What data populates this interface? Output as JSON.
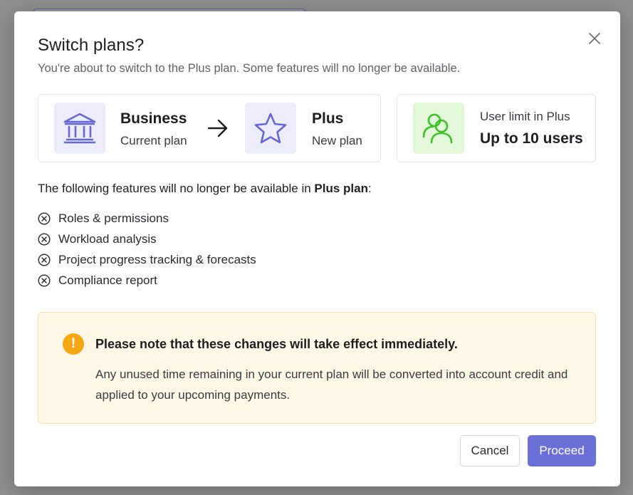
{
  "dialog": {
    "title": "Switch plans?",
    "subtitle": "You're about to switch to the Plus plan. Some features will no longer be available."
  },
  "plans": {
    "current": {
      "name": "Business",
      "caption": "Current plan",
      "icon": "bank-icon"
    },
    "new": {
      "name": "Plus",
      "caption": "New plan",
      "icon": "star-icon"
    }
  },
  "user_limit": {
    "label": "User limit in Plus",
    "value": "Up to 10 users",
    "icon": "users-icon"
  },
  "features": {
    "intro": "The following features will no longer be available in ",
    "intro_plan": "Plus plan",
    "intro_suffix": ":",
    "items": [
      "Roles & permissions",
      "Workload analysis",
      "Project progress tracking & forecasts",
      "Compliance report"
    ]
  },
  "notice": {
    "icon": "!",
    "title": "Please note that these changes will take effect immediately.",
    "body": "Any unused time remaining in your current plan will be converted into account credit and applied to your upcoming payments."
  },
  "buttons": {
    "cancel": "Cancel",
    "proceed": "Proceed"
  },
  "colors": {
    "accent": "#6b6fd8",
    "icon_lavender": "#ececfa",
    "icon_green": "#e3f8d9",
    "notice_bg": "#fff8e6",
    "warning": "#f5a814"
  }
}
